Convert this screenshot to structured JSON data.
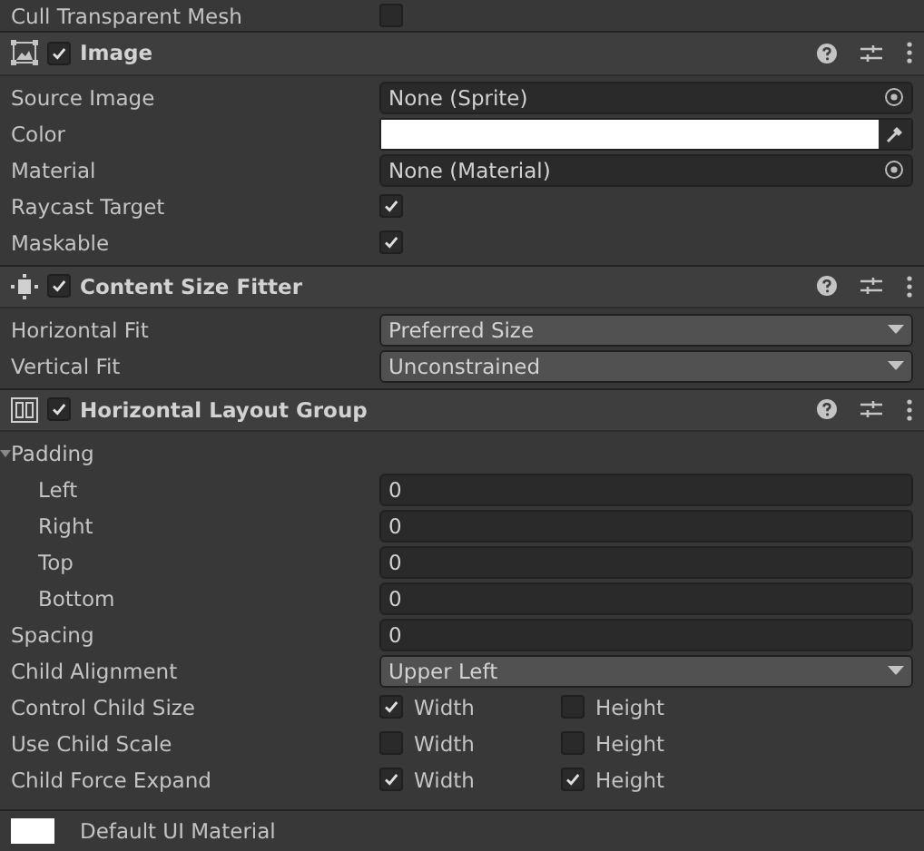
{
  "top_row": {
    "label": "Cull Transparent Mesh",
    "checked": false
  },
  "components": [
    {
      "title": "Image",
      "enabled": true,
      "fields": [
        {
          "kind": "object",
          "label": "Source Image",
          "value": "None (Sprite)"
        },
        {
          "kind": "color",
          "label": "Color",
          "color": "#ffffff"
        },
        {
          "kind": "object",
          "label": "Material",
          "value": "None (Material)"
        },
        {
          "kind": "checkbox",
          "label": "Raycast Target",
          "checked": true
        },
        {
          "kind": "checkbox",
          "label": "Maskable",
          "checked": true
        }
      ]
    },
    {
      "title": "Content Size Fitter",
      "enabled": true,
      "fields": [
        {
          "kind": "dropdown",
          "label": "Horizontal Fit",
          "value": "Preferred Size"
        },
        {
          "kind": "dropdown",
          "label": "Vertical Fit",
          "value": "Unconstrained"
        }
      ]
    },
    {
      "title": "Horizontal Layout Group",
      "enabled": true,
      "fields": [
        {
          "kind": "group",
          "label": "Padding",
          "expanded": true,
          "children": [
            {
              "kind": "number",
              "label": "Left",
              "value": "0"
            },
            {
              "kind": "number",
              "label": "Right",
              "value": "0"
            },
            {
              "kind": "number",
              "label": "Top",
              "value": "0"
            },
            {
              "kind": "number",
              "label": "Bottom",
              "value": "0"
            }
          ]
        },
        {
          "kind": "number",
          "label": "Spacing",
          "value": "0"
        },
        {
          "kind": "dropdown",
          "label": "Child Alignment",
          "value": "Upper Left"
        },
        {
          "kind": "pair",
          "label": "Control Child Size",
          "options": [
            {
              "label": "Width",
              "checked": true
            },
            {
              "label": "Height",
              "checked": false
            }
          ]
        },
        {
          "kind": "pair",
          "label": "Use Child Scale",
          "options": [
            {
              "label": "Width",
              "checked": false
            },
            {
              "label": "Height",
              "checked": false
            }
          ]
        },
        {
          "kind": "pair",
          "label": "Child Force Expand",
          "options": [
            {
              "label": "Width",
              "checked": true
            },
            {
              "label": "Height",
              "checked": true
            }
          ]
        }
      ]
    }
  ],
  "material": {
    "name": "Default UI Material"
  }
}
